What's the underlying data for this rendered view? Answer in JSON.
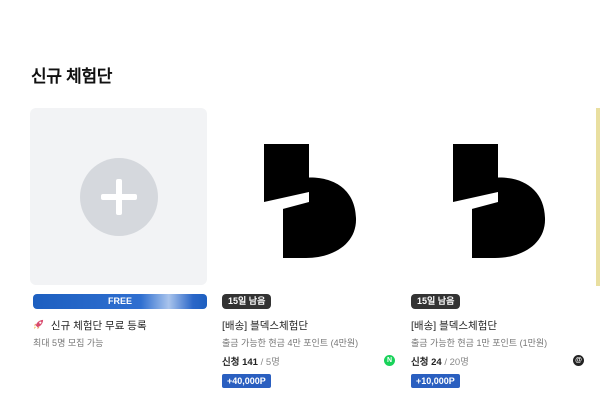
{
  "section": {
    "title": "신규 체험단"
  },
  "cards": [
    {
      "badge": "FREE",
      "icon": "rocket",
      "title": "신규 체험단 무료 등록",
      "subtitle": "최대 5명 모집 가능"
    },
    {
      "badge": "15일 남음",
      "title": "[배송] 블덱스체험단",
      "subtitle": "출금 가능한 현금 4만 포인트 (4만원)",
      "apply_label": "신청 141",
      "apply_total": " / 5명",
      "platform": "naver-blog",
      "platform_glyph": "N",
      "points": "+40,000P"
    },
    {
      "badge": "15일 남음",
      "title": "[배송] 블덱스체험단",
      "subtitle": "출금 가능한 현금 1만 포인트 (1만원)",
      "apply_label": "신청 24",
      "apply_total": " / 20명",
      "platform": "threads",
      "platform_glyph": "@",
      "points": "+10,000P"
    }
  ],
  "colors": {
    "free_bar": "#1d5fc0",
    "days_badge": "#333333",
    "point_badge": "#2a5fc0",
    "naver": "#19d25a"
  }
}
